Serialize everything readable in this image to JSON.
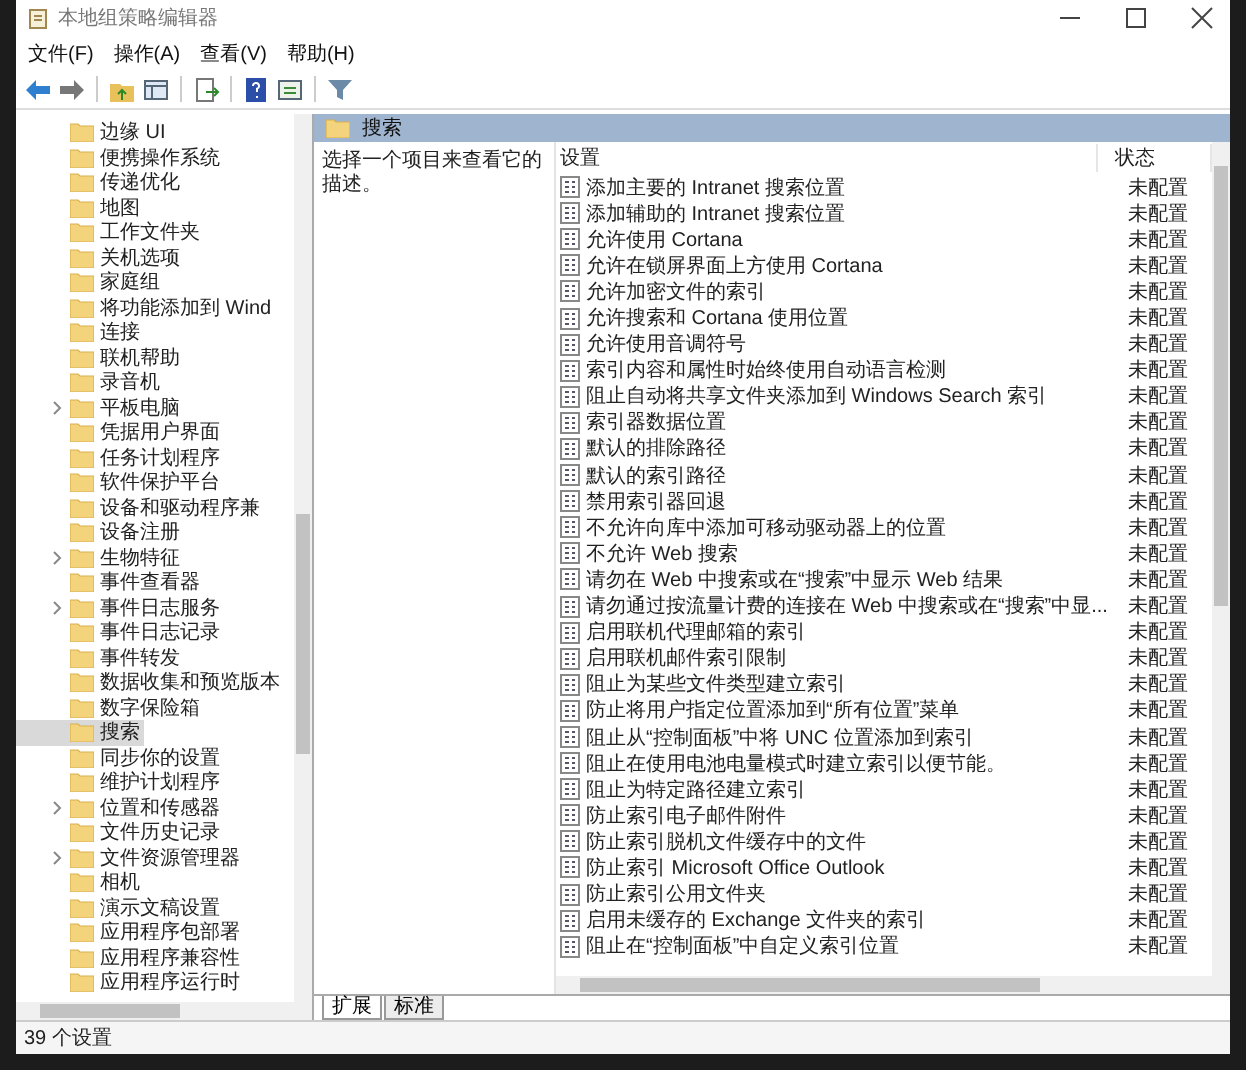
{
  "window": {
    "title": "本地组策略编辑器"
  },
  "menu": [
    "文件(F)",
    "操作(A)",
    "查看(V)",
    "帮助(H)"
  ],
  "tree": [
    {
      "label": "边缘 UI",
      "expandable": false,
      "selected": false
    },
    {
      "label": "便携操作系统",
      "expandable": false,
      "selected": false
    },
    {
      "label": "传递优化",
      "expandable": false,
      "selected": false
    },
    {
      "label": "地图",
      "expandable": false,
      "selected": false
    },
    {
      "label": "工作文件夹",
      "expandable": false,
      "selected": false
    },
    {
      "label": "关机选项",
      "expandable": false,
      "selected": false
    },
    {
      "label": "家庭组",
      "expandable": false,
      "selected": false
    },
    {
      "label": "将功能添加到 Wind",
      "expandable": false,
      "selected": false
    },
    {
      "label": "连接",
      "expandable": false,
      "selected": false
    },
    {
      "label": "联机帮助",
      "expandable": false,
      "selected": false
    },
    {
      "label": "录音机",
      "expandable": false,
      "selected": false
    },
    {
      "label": "平板电脑",
      "expandable": true,
      "selected": false
    },
    {
      "label": "凭据用户界面",
      "expandable": false,
      "selected": false
    },
    {
      "label": "任务计划程序",
      "expandable": false,
      "selected": false
    },
    {
      "label": "软件保护平台",
      "expandable": false,
      "selected": false
    },
    {
      "label": "设备和驱动程序兼",
      "expandable": false,
      "selected": false
    },
    {
      "label": "设备注册",
      "expandable": false,
      "selected": false
    },
    {
      "label": "生物特征",
      "expandable": true,
      "selected": false
    },
    {
      "label": "事件查看器",
      "expandable": false,
      "selected": false
    },
    {
      "label": "事件日志服务",
      "expandable": true,
      "selected": false
    },
    {
      "label": "事件日志记录",
      "expandable": false,
      "selected": false
    },
    {
      "label": "事件转发",
      "expandable": false,
      "selected": false
    },
    {
      "label": "数据收集和预览版本",
      "expandable": false,
      "selected": false
    },
    {
      "label": "数字保险箱",
      "expandable": false,
      "selected": false
    },
    {
      "label": "搜索",
      "expandable": false,
      "selected": true
    },
    {
      "label": "同步你的设置",
      "expandable": false,
      "selected": false
    },
    {
      "label": "维护计划程序",
      "expandable": false,
      "selected": false
    },
    {
      "label": "位置和传感器",
      "expandable": true,
      "selected": false
    },
    {
      "label": "文件历史记录",
      "expandable": false,
      "selected": false
    },
    {
      "label": "文件资源管理器",
      "expandable": true,
      "selected": false
    },
    {
      "label": "相机",
      "expandable": false,
      "selected": false
    },
    {
      "label": "演示文稿设置",
      "expandable": false,
      "selected": false
    },
    {
      "label": "应用程序包部署",
      "expandable": false,
      "selected": false
    },
    {
      "label": "应用程序兼容性",
      "expandable": false,
      "selected": false
    },
    {
      "label": "应用程序运行时",
      "expandable": false,
      "selected": false
    }
  ],
  "header": {
    "title": "搜索"
  },
  "description": "选择一个项目来查看它的描述。",
  "columns": [
    "设置",
    "状态"
  ],
  "rows": [
    {
      "name": "添加主要的 Intranet 搜索位置",
      "state": "未配置"
    },
    {
      "name": "添加辅助的 Intranet 搜索位置",
      "state": "未配置"
    },
    {
      "name": "允许使用 Cortana",
      "state": "未配置"
    },
    {
      "name": "允许在锁屏界面上方使用 Cortana",
      "state": "未配置"
    },
    {
      "name": "允许加密文件的索引",
      "state": "未配置"
    },
    {
      "name": "允许搜索和 Cortana 使用位置",
      "state": "未配置"
    },
    {
      "name": "允许使用音调符号",
      "state": "未配置"
    },
    {
      "name": "索引内容和属性时始终使用自动语言检测",
      "state": "未配置"
    },
    {
      "name": "阻止自动将共享文件夹添加到 Windows Search 索引",
      "state": "未配置"
    },
    {
      "name": "索引器数据位置",
      "state": "未配置"
    },
    {
      "name": "默认的排除路径",
      "state": "未配置"
    },
    {
      "name": "默认的索引路径",
      "state": "未配置"
    },
    {
      "name": "禁用索引器回退",
      "state": "未配置"
    },
    {
      "name": "不允许向库中添加可移动驱动器上的位置",
      "state": "未配置"
    },
    {
      "name": "不允许 Web 搜索",
      "state": "未配置"
    },
    {
      "name": "请勿在 Web 中搜索或在“搜索”中显示 Web 结果",
      "state": "未配置"
    },
    {
      "name": "请勿通过按流量计费的连接在 Web 中搜索或在“搜索”中显...",
      "state": "未配置"
    },
    {
      "name": "启用联机代理邮箱的索引",
      "state": "未配置"
    },
    {
      "name": "启用联机邮件索引限制",
      "state": "未配置"
    },
    {
      "name": "阻止为某些文件类型建立索引",
      "state": "未配置"
    },
    {
      "name": "防止将用户指定位置添加到“所有位置”菜单",
      "state": "未配置"
    },
    {
      "name": "阻止从“控制面板”中将 UNC 位置添加到索引",
      "state": "未配置"
    },
    {
      "name": "阻止在使用电池电量模式时建立索引以便节能。",
      "state": "未配置"
    },
    {
      "name": "阻止为特定路径建立索引",
      "state": "未配置"
    },
    {
      "name": "防止索引电子邮件附件",
      "state": "未配置"
    },
    {
      "name": "防止索引脱机文件缓存中的文件",
      "state": "未配置"
    },
    {
      "name": "防止索引 Microsoft Office Outlook",
      "state": "未配置"
    },
    {
      "name": "防止索引公用文件夹",
      "state": "未配置"
    },
    {
      "name": "启用未缓存的 Exchange 文件夹的索引",
      "state": "未配置"
    },
    {
      "name": "阻止在“控制面板”中自定义索引位置",
      "state": "未配置"
    }
  ],
  "tabs": [
    {
      "label": "扩展",
      "selected": true
    },
    {
      "label": "标准",
      "selected": false
    }
  ],
  "status_bar": "39 个设置"
}
